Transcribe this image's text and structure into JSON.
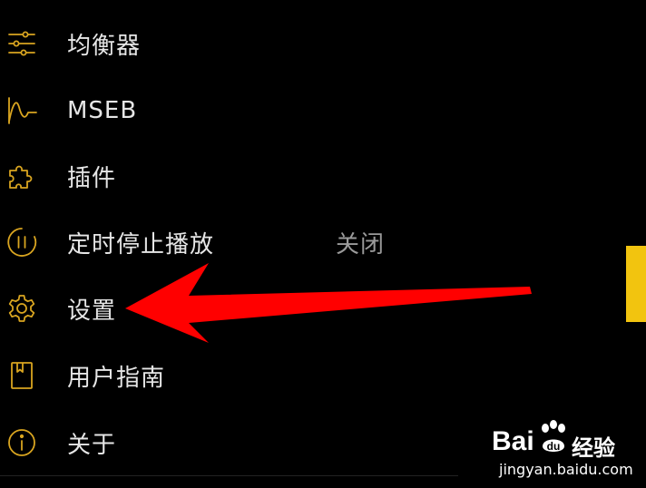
{
  "menu": {
    "items": [
      {
        "label": "均衡器",
        "icon": "equalizer-sliders-icon",
        "value": ""
      },
      {
        "label": "MSEB",
        "icon": "waveform-icon",
        "value": ""
      },
      {
        "label": "插件",
        "icon": "puzzle-piece-icon",
        "value": ""
      },
      {
        "label": "定时停止播放",
        "icon": "pause-timer-icon",
        "value": "关闭"
      },
      {
        "label": "设置",
        "icon": "gear-icon",
        "value": ""
      },
      {
        "label": "用户指南",
        "icon": "book-icon",
        "value": ""
      },
      {
        "label": "关于",
        "icon": "info-icon",
        "value": ""
      }
    ]
  },
  "annotation": {
    "arrow_color": "#ff0000",
    "arrow_points_to": "设置"
  },
  "colors": {
    "background": "#000000",
    "icon_accent": "#d9a520",
    "scroll_tab": "#f2c40f",
    "text": "#e6e6e6",
    "value_text": "#9a9a9a"
  },
  "watermark": {
    "logo_left": "Bai",
    "logo_right": "经验",
    "url": "jingyan.baidu.com"
  }
}
